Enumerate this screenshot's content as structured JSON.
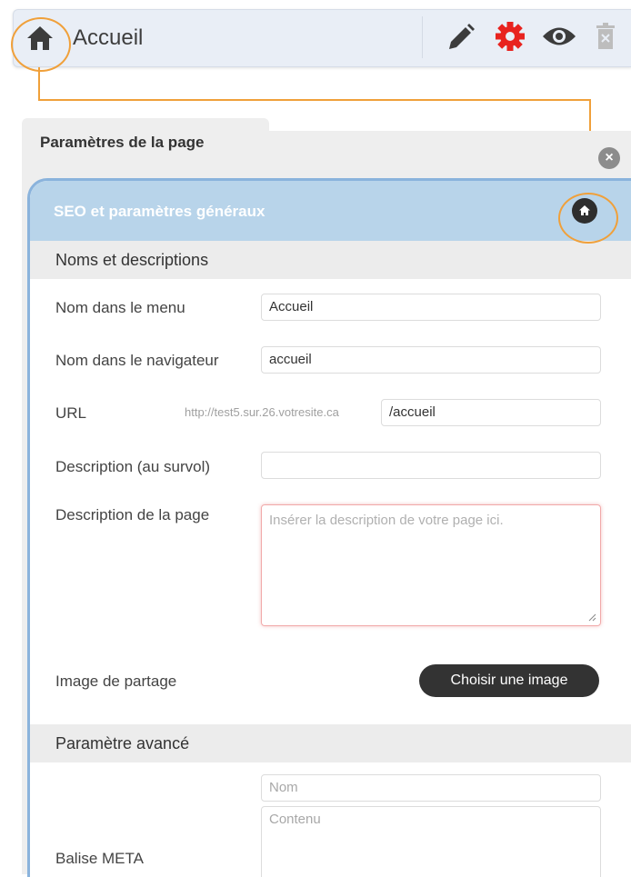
{
  "topbar": {
    "title": "Accueil",
    "icons": [
      "home-icon",
      "pencil-icon",
      "gear-icon",
      "eye-icon",
      "trash-icon"
    ],
    "colors": {
      "gear": "#e8231f",
      "dark": "#3c3c3c",
      "callout": "#f0a03a"
    }
  },
  "panel": {
    "title": "Paramètres de la page",
    "close_icon": "close-icon",
    "seo_header": "SEO et paramètres généraux",
    "seo_header_color": "#b8d4ea"
  },
  "names_section": {
    "title": "Noms et descriptions",
    "menu_name_label": "Nom dans le menu",
    "menu_name_value": "Accueil",
    "browser_name_label": "Nom dans le navigateur",
    "browser_name_value": "accueil",
    "url_label": "URL",
    "url_prefix": "http://test5.sur.26.votresite.ca",
    "url_value": "/accueil",
    "hover_desc_label": "Description (au survol)",
    "hover_desc_value": "",
    "page_desc_label": "Description de la page",
    "page_desc_placeholder": "Insérer la description de votre page ici.",
    "share_image_label": "Image de partage",
    "choose_image_button": "Choisir une image"
  },
  "advanced_section": {
    "title": "Paramètre avancé",
    "meta_label": "Balise META",
    "meta_name_placeholder": "Nom",
    "meta_content_placeholder": "Contenu"
  }
}
